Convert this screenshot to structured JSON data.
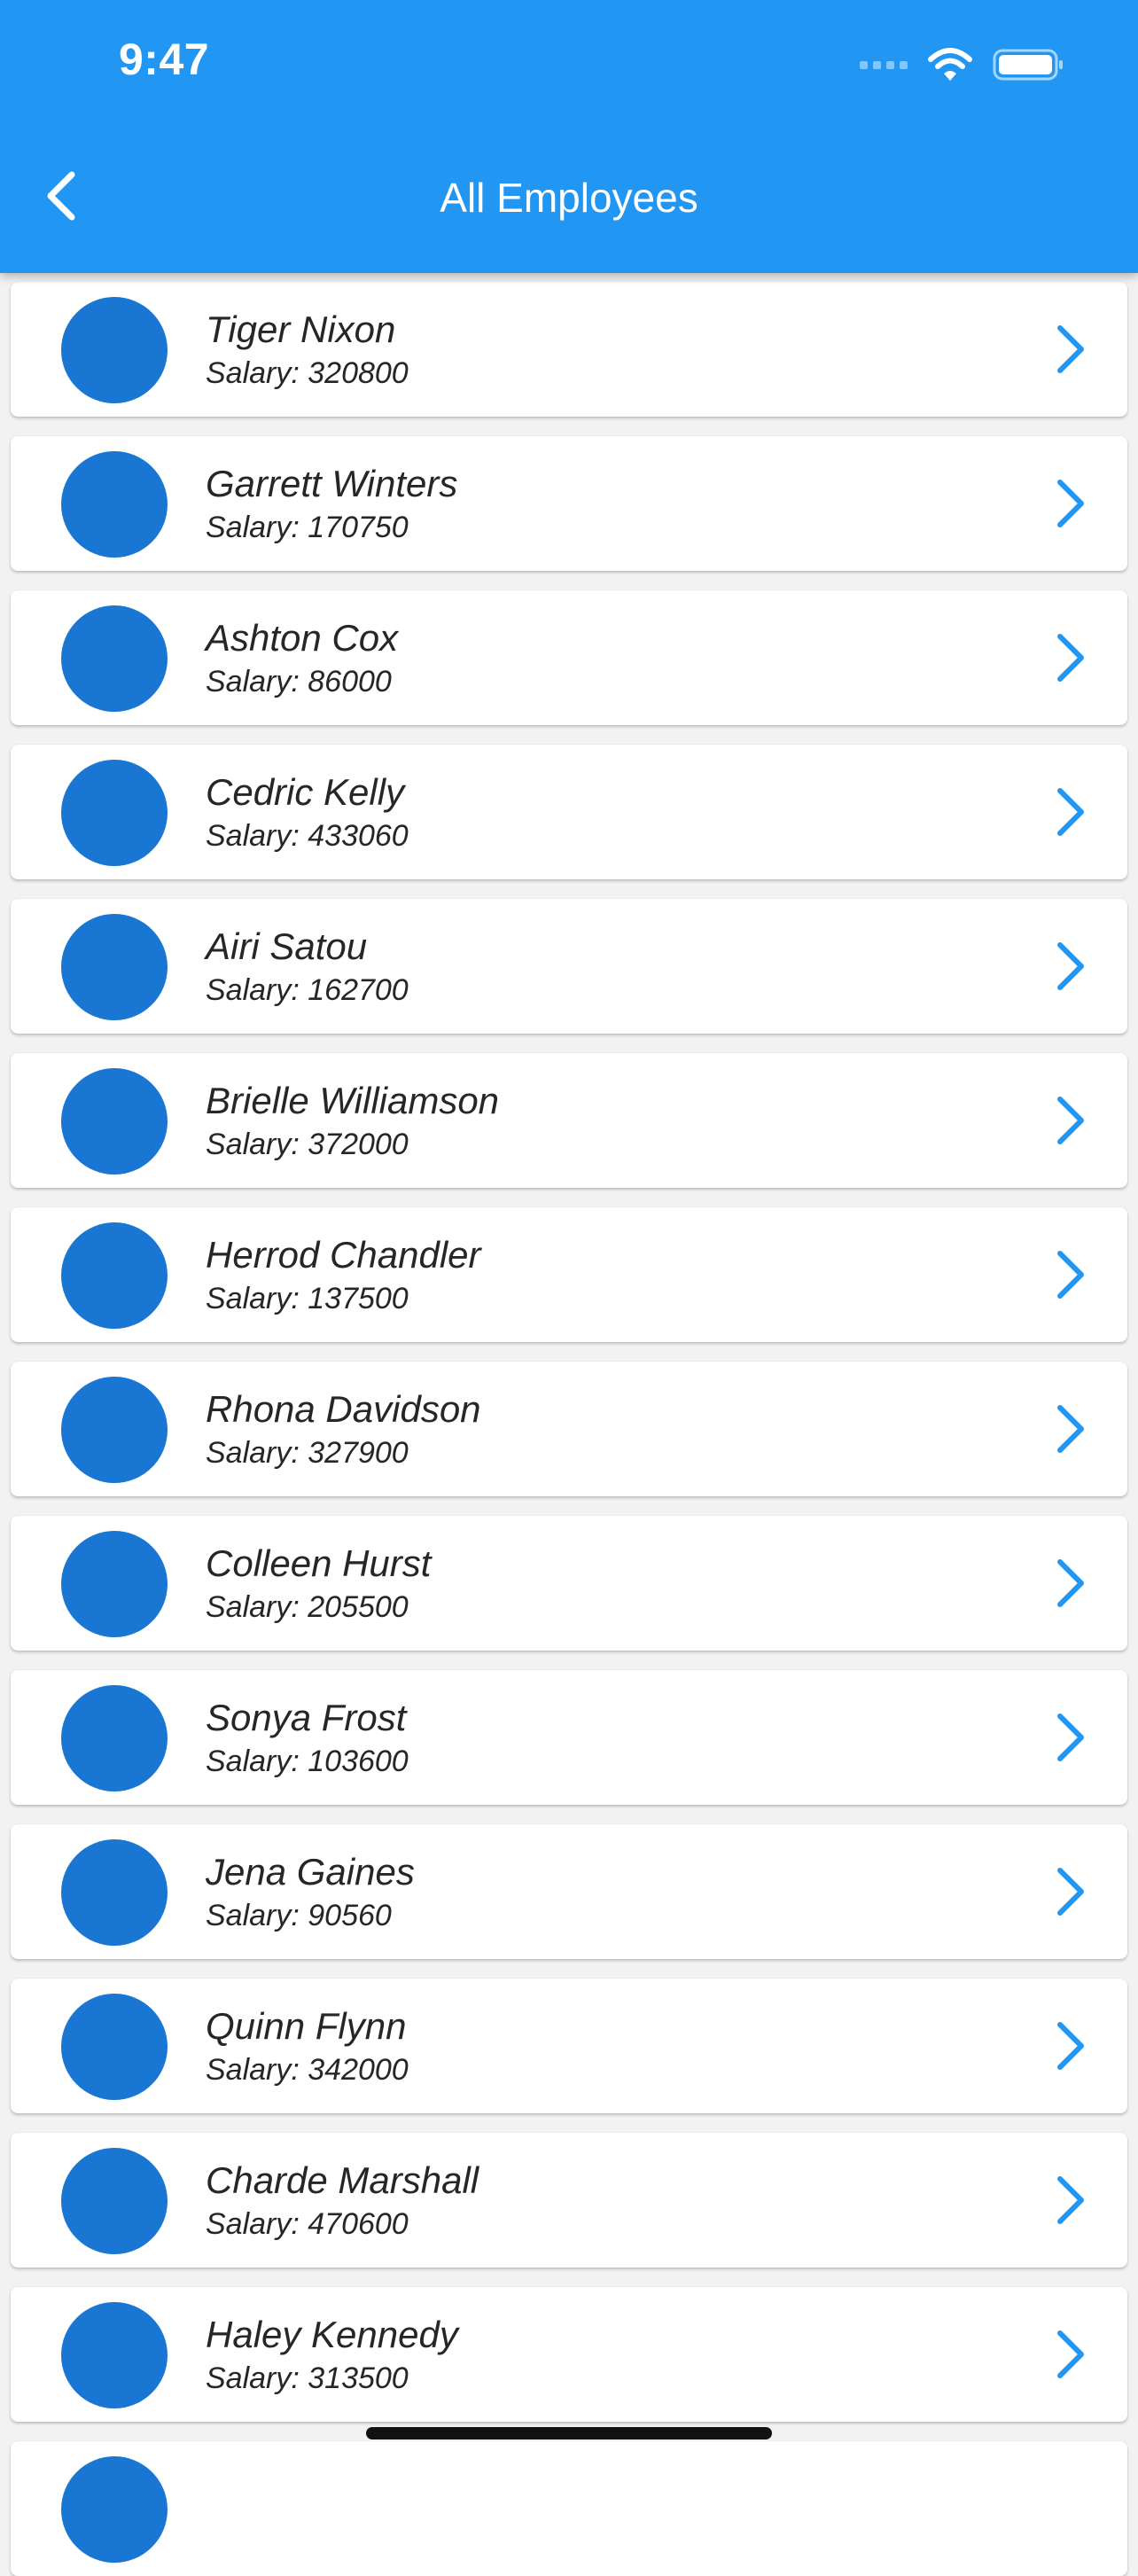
{
  "status_bar": {
    "time": "9:47"
  },
  "header": {
    "title": "All Employees",
    "back_icon": "chevron-left-icon"
  },
  "colors": {
    "app_bar": "#2196f3",
    "avatar": "#1976d2",
    "chevron": "#2196f3",
    "background": "#f2f2f2"
  },
  "employees": [
    {
      "name": "Tiger Nixon",
      "salary": "Salary: 320800"
    },
    {
      "name": "Garrett Winters",
      "salary": "Salary: 170750"
    },
    {
      "name": "Ashton Cox",
      "salary": "Salary: 86000"
    },
    {
      "name": "Cedric Kelly",
      "salary": "Salary: 433060"
    },
    {
      "name": "Airi Satou",
      "salary": "Salary: 162700"
    },
    {
      "name": "Brielle Williamson",
      "salary": "Salary: 372000"
    },
    {
      "name": "Herrod Chandler",
      "salary": "Salary: 137500"
    },
    {
      "name": "Rhona Davidson",
      "salary": "Salary: 327900"
    },
    {
      "name": "Colleen Hurst",
      "salary": "Salary: 205500"
    },
    {
      "name": "Sonya Frost",
      "salary": "Salary: 103600"
    },
    {
      "name": "Jena Gaines",
      "salary": "Salary: 90560"
    },
    {
      "name": "Quinn Flynn",
      "salary": "Salary: 342000"
    },
    {
      "name": "Charde Marshall",
      "salary": "Salary: 470600"
    },
    {
      "name": "Haley Kennedy",
      "salary": "Salary: 313500"
    },
    {
      "name": "",
      "salary": ""
    }
  ]
}
